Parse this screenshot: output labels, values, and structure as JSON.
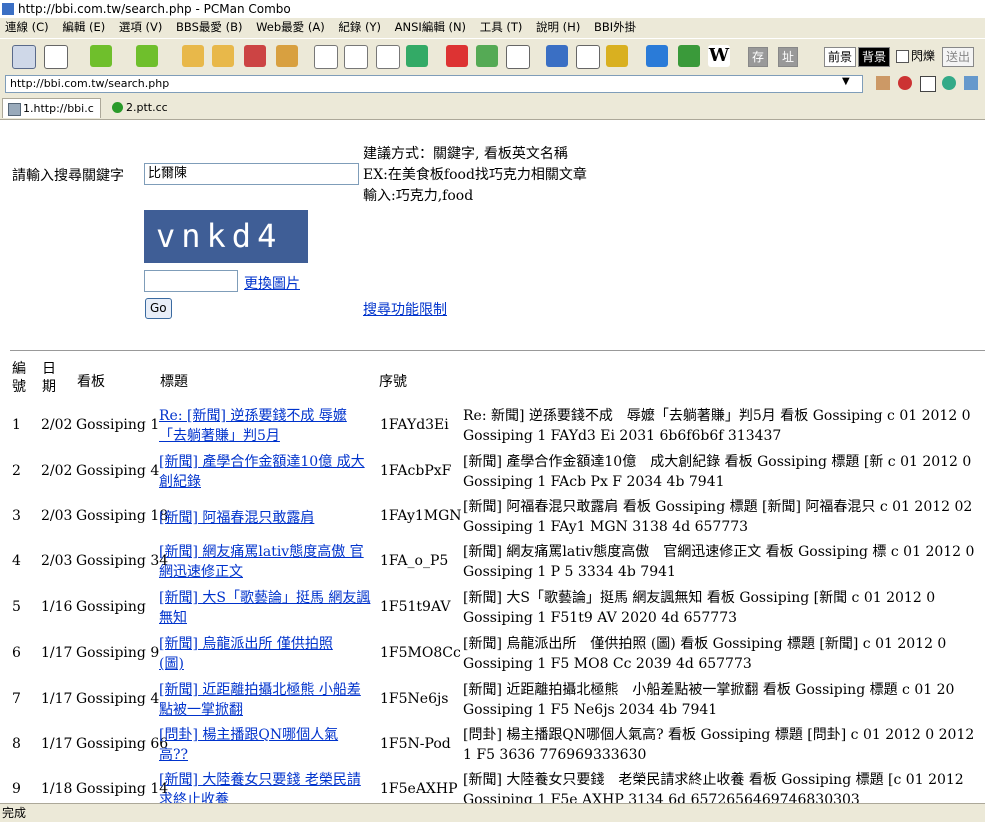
{
  "window": {
    "title": "http://bbi.com.tw/search.php - PCMan Combo"
  },
  "menu": [
    "連線 (C)",
    "編輯 (E)",
    "選項 (V)",
    "BBS最愛 (B)",
    "Web最愛 (A)",
    "紀錄 (Y)",
    "ANSI編輯 (N)",
    "工具 (T)",
    "說明 (H)",
    "BBI外掛"
  ],
  "toolbar": {
    "fg_label": "前景",
    "bg_label": "背景",
    "blink_label": "閃爍",
    "send_label": "送出",
    "save_label": "存",
    "addr_label": "址"
  },
  "address": "http://bbi.com.tw/search.php",
  "tabs": [
    {
      "label": "1.http://bbi.c"
    },
    {
      "label": "2.ptt.cc"
    }
  ],
  "search": {
    "prompt": "請輸入搜尋關鍵字",
    "value": "比爾陳",
    "hint1": "建議方式：關鍵字, 看板英文名稱",
    "hint2": "EX:在美食板food找巧克力相關文章",
    "hint3": "輸入:巧克力,food",
    "captcha_text": "vnkd4",
    "captcha_value": "",
    "change_image": "更換圖片",
    "go": "Go",
    "limits": "搜尋功能限制"
  },
  "table": {
    "headers": {
      "num1": "編",
      "num2": "號",
      "date1": "日",
      "date2": "期",
      "board": "看板",
      "title": "標題",
      "serial": "序號"
    },
    "rows": [
      {
        "num": "1",
        "date": "2/02",
        "board": "Gossiping 1",
        "title": "Re: [新聞] 逆孫要錢不成 辱嬤「去躺著賺」判5月",
        "serial": "1FAYd3Ei",
        "desc1": "Re: 新聞] 逆孫要錢不成　辱嬤「去躺著賺」判5月 看板 Gossiping c 01 2012 0",
        "desc2": "Gossiping 1 FAYd3 Ei 2031 6b6f6b6f 313437"
      },
      {
        "num": "2",
        "date": "2/02",
        "board": "Gossiping 4",
        "title": "[新聞] 產學合作金額達10億 成大創紀錄",
        "serial": "1FAcbPxF",
        "desc1": "[新聞] 產學合作金額達10億　成大創紀錄 看板 Gossiping 標題 [新 c 01 2012 0",
        "desc2": "Gossiping 1 FAcb Px F 2034 4b 7941"
      },
      {
        "num": "3",
        "date": "2/03",
        "board": "Gossiping 18",
        "title": "[新聞] 阿福春混只敢露肩",
        "serial": "1FAy1MGN",
        "desc1": "[新聞] 阿福春混只敢露肩 看板 Gossiping 標題 [新聞] 阿福春混只 c 01 2012 02",
        "desc2": "Gossiping 1 FAy1 MGN 3138 4d 657773"
      },
      {
        "num": "4",
        "date": "2/03",
        "board": "Gossiping 34",
        "title": "[新聞] 網友痛罵lativ態度高傲 官網迅速修正文",
        "serial": "1FA_o_P5",
        "desc1": "[新聞] 網友痛罵lativ態度高傲　官網迅速修正文 看板 Gossiping 標 c 01 2012 0",
        "desc2": "Gossiping 1 P 5 3334 4b 7941"
      },
      {
        "num": "5",
        "date": "1/16",
        "board": "Gossiping",
        "title": "[新聞] 大S「歌藝論」挺馬 網友諷無知",
        "serial": "1F51t9AV",
        "desc1": "[新聞] 大S「歌藝論」挺馬 網友諷無知 看板 Gossiping [新聞 c 01 2012 0",
        "desc2": "Gossiping 1 F51t9 AV 2020 4d 657773"
      },
      {
        "num": "6",
        "date": "1/17",
        "board": "Gossiping 9",
        "title": "[新聞] 烏龍派出所 僅供拍照 (圖)",
        "serial": "1F5MO8Cc",
        "desc1": "[新聞] 烏龍派出所　僅供拍照 (圖) 看板 Gossiping 標題 [新聞] c 01 2012 0",
        "desc2": "Gossiping 1 F5 MO8 Cc 2039 4d 657773"
      },
      {
        "num": "7",
        "date": "1/17",
        "board": "Gossiping 4",
        "title": "[新聞] 近距離拍攝北極熊 小船差點被一掌掀翻",
        "serial": "1F5Ne6js",
        "desc1": "[新聞] 近距離拍攝北極熊　小船差點被一掌掀翻 看板 Gossiping 標題 c 01 20",
        "desc2": "Gossiping 1 F5 Ne6js 2034 4b 7941"
      },
      {
        "num": "8",
        "date": "1/17",
        "board": "Gossiping 66",
        "title": "[問卦] 楊主播跟QN哪個人氣高??",
        "serial": "1F5N-Pod",
        "desc1": "[問卦] 楊主播跟QN哪個人氣高? 看板 Gossiping 標題 [問卦] c 01 2012 0 2012",
        "desc2": "1 F5 3636 776969333630"
      },
      {
        "num": "9",
        "date": "1/18",
        "board": "Gossiping 14",
        "title": "[新聞] 大陸養女只要錢 老榮民請求終止收養",
        "serial": "1F5eAXHP",
        "desc1": "[新聞] 大陸養女只要錢　老榮民請求終止收養 看板 Gossiping 標題 [c 01 2012",
        "desc2": "Gossiping 1 F5e AXHP 3134 6d 6572656469746830303"
      }
    ]
  },
  "status": "完成"
}
